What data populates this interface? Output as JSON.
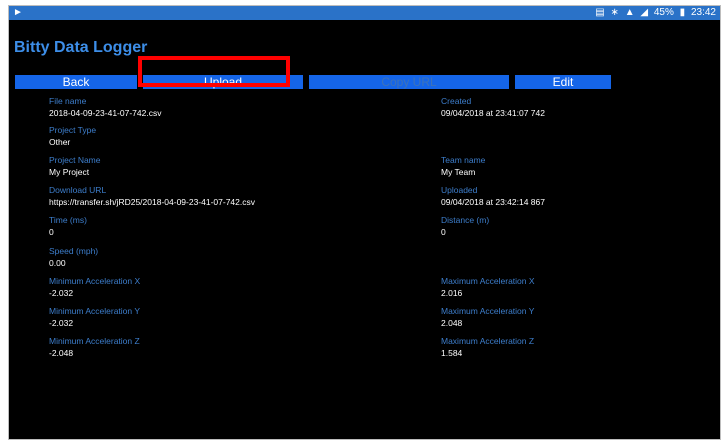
{
  "status_bar": {
    "left_icon": "play-arrow-icon",
    "icons": [
      "nfc-icon",
      "bluetooth-icon",
      "wifi-icon",
      "signal-icon",
      "battery-icon"
    ],
    "battery_percent": "45%",
    "time": "23:42"
  },
  "app": {
    "title": "Bitty Data Logger"
  },
  "toolbar": {
    "back_label": "Back",
    "upload_label": "Upload",
    "copy_url_label": "Copy URL",
    "edit_label": "Edit"
  },
  "fields": {
    "file_name": {
      "label": "File name",
      "value": "2018-04-09-23-41-07-742.csv"
    },
    "created": {
      "label": "Created",
      "value": "09/04/2018 at 23:41:07 742"
    },
    "project_type": {
      "label": "Project Type",
      "value": "Other"
    },
    "project_name": {
      "label": "Project Name",
      "value": "My Project"
    },
    "team_name": {
      "label": "Team name",
      "value": "My Team"
    },
    "download_url": {
      "label": "Download URL",
      "value": "https://transfer.sh/jRD25/2018-04-09-23-41-07-742.csv"
    },
    "uploaded": {
      "label": "Uploaded",
      "value": "09/04/2018 at 23:42:14 867"
    },
    "time_ms": {
      "label": "Time (ms)",
      "value": "0"
    },
    "distance_m": {
      "label": "Distance (m)",
      "value": "0"
    },
    "speed_mph": {
      "label": "Speed (mph)",
      "value": "0.00"
    },
    "min_acc_x": {
      "label": "Minimum Acceleration X",
      "value": "-2.032"
    },
    "max_acc_x": {
      "label": "Maximum Acceleration X",
      "value": "2.016"
    },
    "min_acc_y": {
      "label": "Minimum Acceleration Y",
      "value": "-2.032"
    },
    "max_acc_y": {
      "label": "Maximum Acceleration Y",
      "value": "2.048"
    },
    "min_acc_z": {
      "label": "Minimum Acceleration Z",
      "value": "-2.048"
    },
    "max_acc_z": {
      "label": "Maximum Acceleration Z",
      "value": "1.584"
    }
  },
  "colors": {
    "status_bar": "#2a72c8",
    "title": "#3d8ee8",
    "button": "#1565e8",
    "label": "#3d7ecc",
    "highlight": "#ff0000"
  }
}
